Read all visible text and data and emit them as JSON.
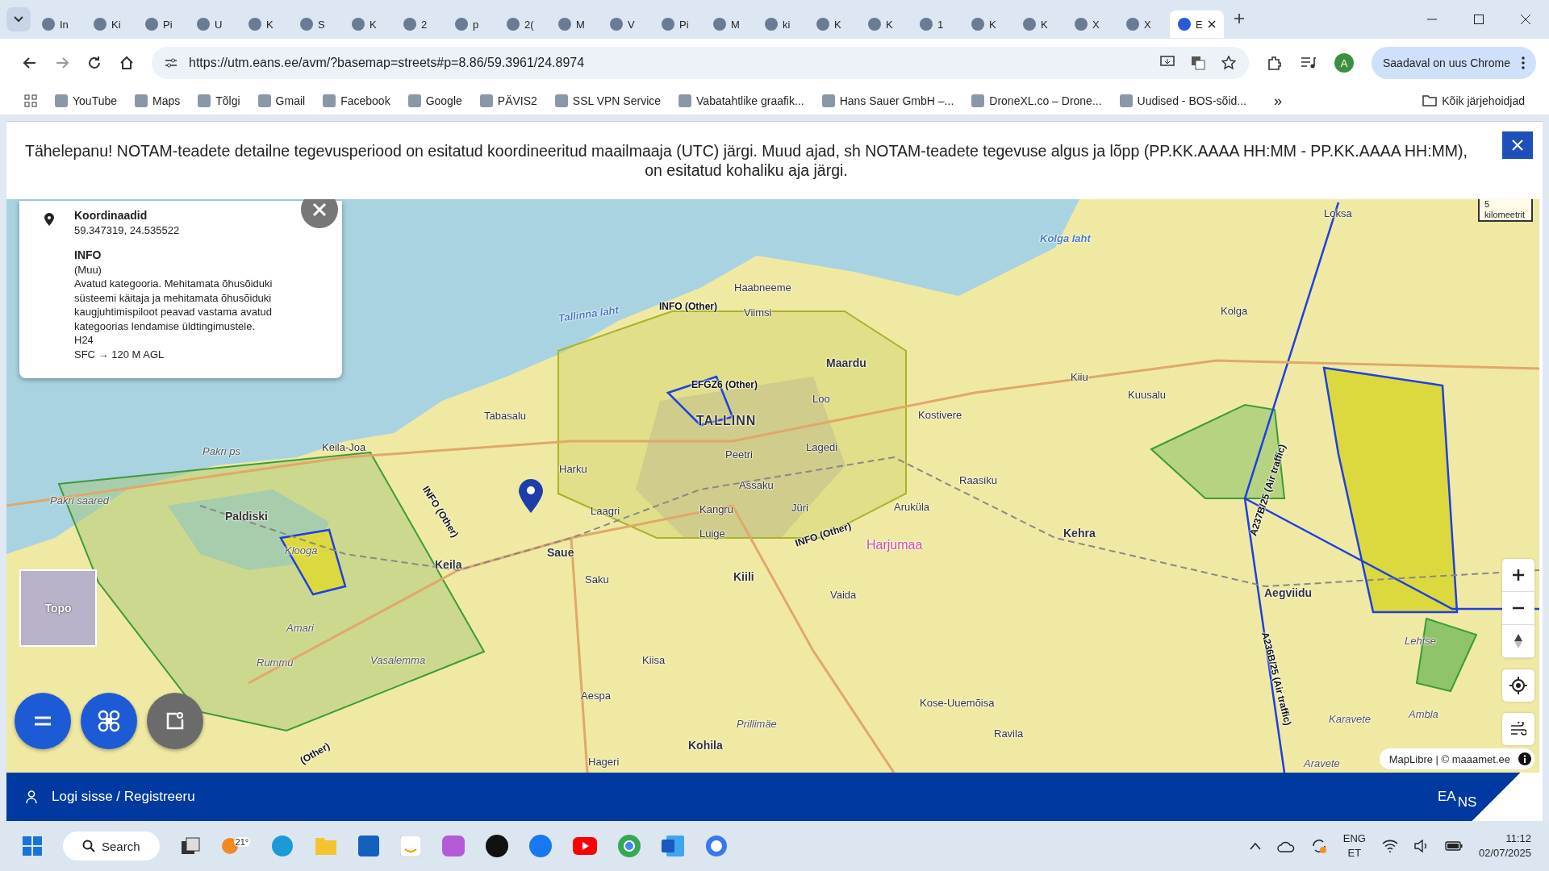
{
  "tabs": [
    {
      "label": "In",
      "selected": false
    },
    {
      "label": "Ki",
      "selected": false
    },
    {
      "label": "Pi",
      "selected": false
    },
    {
      "label": "U",
      "selected": false
    },
    {
      "label": "K",
      "selected": false
    },
    {
      "label": "S",
      "selected": false
    },
    {
      "label": "K",
      "selected": false
    },
    {
      "label": "2",
      "selected": false
    },
    {
      "label": "p",
      "selected": false
    },
    {
      "label": "2(",
      "selected": false
    },
    {
      "label": "M",
      "selected": false
    },
    {
      "label": "V",
      "selected": false
    },
    {
      "label": "Pi",
      "selected": false
    },
    {
      "label": "M",
      "selected": false
    },
    {
      "label": "ki",
      "selected": false
    },
    {
      "label": "K",
      "selected": false
    },
    {
      "label": "K",
      "selected": false
    },
    {
      "label": "1",
      "selected": false
    },
    {
      "label": "K",
      "selected": false
    },
    {
      "label": "K",
      "selected": false
    },
    {
      "label": "X",
      "selected": false
    },
    {
      "label": "X",
      "selected": false
    },
    {
      "label": "E",
      "selected": true
    }
  ],
  "address": "https://utm.eans.ee/avm/?basemap=streets#p=8.86/59.3961/24.8974",
  "profile": "A",
  "update_button": "Saadaval on uus Chrome",
  "bookmarks": [
    "YouTube",
    "Maps",
    "Tõlgi",
    "Gmail",
    "Facebook",
    "Google",
    "PÄVIS2",
    "SSL VPN Service",
    "Vabatahtlike graafik...",
    "Hans Sauer GmbH –...",
    "DroneXL.co – Drone...",
    "Uudised - BOS-sõid..."
  ],
  "bookmarks_more": "»",
  "all_bookmarks": "Kõik järjehoidjad",
  "notice": "Tähelepanu! NOTAM-teadete detailne tegevusperiood on esitatud koordineeritud maailmaaja (UTC) järgi. Muud ajad, sh NOTAM-teadete tegevuse algus ja lõpp (PP.KK.AAAA HH:MM - PP.KK.AAAA HH:MM), on esitatud kohaliku aja järgi.",
  "info_panel": {
    "coord_title": "Koordinaadid",
    "coords": "59.347319, 24.535522",
    "info_title": "INFO",
    "lines": [
      "(Muu)",
      "Avatud kategooria. Mehitamata õhusõiduki süsteemi käitaja ja mehitamata õhusõiduki kaugjuhtimispiloot peavad vastama avatud kategoorias lendamise üldtingimustele.",
      "H24",
      "SFC → 120 M AGL"
    ]
  },
  "map": {
    "places": [
      {
        "name": "INFO (Other)",
        "kind": "zone"
      },
      {
        "name": "Tallinna laht",
        "kind": "water"
      },
      {
        "name": "Haabneeme",
        "kind": "village"
      },
      {
        "name": "Viimsi",
        "kind": "village"
      },
      {
        "name": "Kolga laht",
        "kind": "water"
      },
      {
        "name": "Loksa",
        "kind": "village"
      },
      {
        "name": "Kolga",
        "kind": "village"
      },
      {
        "name": "Maardu",
        "kind": "town"
      },
      {
        "name": "EFGZ6 (Other)",
        "kind": "zone"
      },
      {
        "name": "TALLINN",
        "kind": "city"
      },
      {
        "name": "Loo",
        "kind": "village"
      },
      {
        "name": "Kostivere",
        "kind": "village"
      },
      {
        "name": "Kiiu",
        "kind": "village"
      },
      {
        "name": "Kuusalu",
        "kind": "village"
      },
      {
        "name": "Tabasalu",
        "kind": "village"
      },
      {
        "name": "Lagedi",
        "kind": "village"
      },
      {
        "name": "Peetri",
        "kind": "village"
      },
      {
        "name": "Harku",
        "kind": "village"
      },
      {
        "name": "Assaku",
        "kind": "village"
      },
      {
        "name": "Keila-Joa",
        "kind": "village"
      },
      {
        "name": "Pakri ps",
        "kind": "area"
      },
      {
        "name": "Pakri saared",
        "kind": "area"
      },
      {
        "name": "Paldiski",
        "kind": "town"
      },
      {
        "name": "Laagri",
        "kind": "village"
      },
      {
        "name": "Kangru",
        "kind": "village"
      },
      {
        "name": "Jüri",
        "kind": "village"
      },
      {
        "name": "Aruküla",
        "kind": "village"
      },
      {
        "name": "Raasiku",
        "kind": "village"
      },
      {
        "name": "Kehra",
        "kind": "town"
      },
      {
        "name": "Harjumaa",
        "kind": "region"
      },
      {
        "name": "INFO (Other)",
        "kind": "zone"
      },
      {
        "name": "Luige",
        "kind": "village"
      },
      {
        "name": "Saue",
        "kind": "town"
      },
      {
        "name": "Keila",
        "kind": "town"
      },
      {
        "name": "Klooga",
        "kind": "area"
      },
      {
        "name": "Saku",
        "kind": "village"
      },
      {
        "name": "Kiili",
        "kind": "town"
      },
      {
        "name": "Vaida",
        "kind": "village"
      },
      {
        "name": "Aegviidu",
        "kind": "town"
      },
      {
        "name": "Amari",
        "kind": "area"
      },
      {
        "name": "Rummu",
        "kind": "area"
      },
      {
        "name": "Vasalemma",
        "kind": "area"
      },
      {
        "name": "Kiisa",
        "kind": "village"
      },
      {
        "name": "Aespa",
        "kind": "village"
      },
      {
        "name": "Kose-Uuemõisa",
        "kind": "village"
      },
      {
        "name": "Ravila",
        "kind": "village"
      },
      {
        "name": "Prillimäe",
        "kind": "area"
      },
      {
        "name": "Kohila",
        "kind": "town"
      },
      {
        "name": "Hageri",
        "kind": "village"
      },
      {
        "name": "Karavete",
        "kind": "area"
      },
      {
        "name": "Ambla",
        "kind": "area"
      },
      {
        "name": "Aravete",
        "kind": "area"
      },
      {
        "name": "Lehtse",
        "kind": "area"
      },
      {
        "name": "A237B/25 (Air traffic)",
        "kind": "zone"
      },
      {
        "name": "A236B/25 (Air traffic)",
        "kind": "zone"
      },
      {
        "name": "INFO (Other)",
        "kind": "zone"
      },
      {
        "name": "(Other)",
        "kind": "zone"
      }
    ],
    "scale": [
      "5",
      "kilomeetrit"
    ],
    "minimap_label": "Topo",
    "attribution": "MapLibre | © maaamet.ee"
  },
  "login": "Logi sisse / Registreeru",
  "logo": [
    "EA",
    "NS"
  ],
  "taskbar": {
    "search": "Search",
    "weather": "21°",
    "lang": [
      "ENG",
      "ET"
    ],
    "time": "11:12",
    "date": "02/07/2025"
  }
}
